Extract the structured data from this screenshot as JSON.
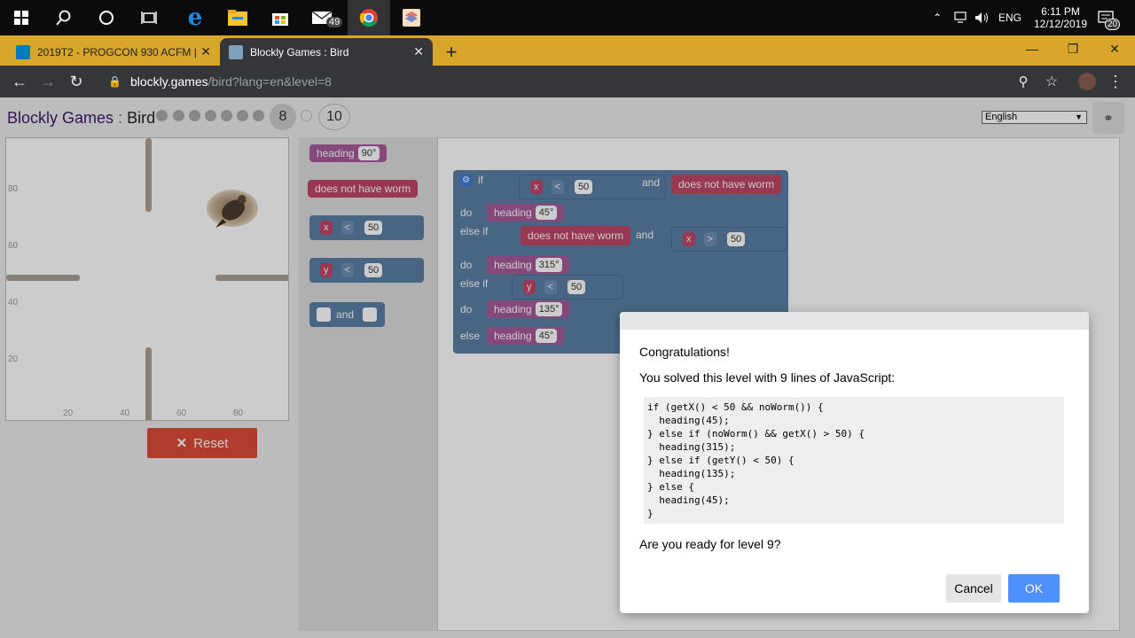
{
  "taskbar": {
    "mail_badge": "49",
    "language": "ENG",
    "time": "6:11 PM",
    "date": "12/12/2019",
    "notification_count": "20"
  },
  "browser": {
    "tabs": [
      {
        "label": "2019T2 - PROGCON 930 ACFM |"
      },
      {
        "label": "Blockly Games : Bird"
      }
    ],
    "new_tab": "+",
    "url_host": "blockly.games",
    "url_path": "/bird?lang=en&level=8"
  },
  "page": {
    "app_title": "Blockly Games",
    "separator": ":",
    "game_title": "Bird",
    "current_level": "8",
    "last_level": "10",
    "language_select": "English",
    "reset_label": "Reset",
    "y_axis_labels": [
      "80",
      "60",
      "40",
      "20"
    ],
    "x_axis_labels": [
      "20",
      "40",
      "60",
      "80"
    ]
  },
  "toolbox": {
    "heading_label": "heading",
    "heading_value": "90°",
    "worm_label": "does not have worm",
    "x_var": "x",
    "y_var": "y",
    "op": "<",
    "compare_value": "50",
    "and_label": "and"
  },
  "workspace": {
    "if_label": "if",
    "do_label": "do",
    "else_if_label": "else if",
    "else_label": "else",
    "and_label": "and",
    "heading_label": "heading",
    "worm_label": "does not have worm",
    "cond1": {
      "var": "x",
      "op": "<",
      "value": "50"
    },
    "cond2": {
      "var": "x",
      "op": ">",
      "value": "50"
    },
    "cond3": {
      "var": "y",
      "op": "<",
      "value": "50"
    },
    "heading1": "45°",
    "heading2": "315°",
    "heading3": "135°",
    "heading4": "45°"
  },
  "dialog": {
    "title": "Congratulations!",
    "message": "You solved this level with 9 lines of JavaScript:",
    "code": "if (getX() < 50 && noWorm()) {\n  heading(45);\n} else if (noWorm() && getX() > 50) {\n  heading(315);\n} else if (getY() < 50) {\n  heading(135);\n} else {\n  heading(45);\n}",
    "question": "Are you ready for level 9?",
    "cancel_label": "Cancel",
    "ok_label": "OK"
  }
}
